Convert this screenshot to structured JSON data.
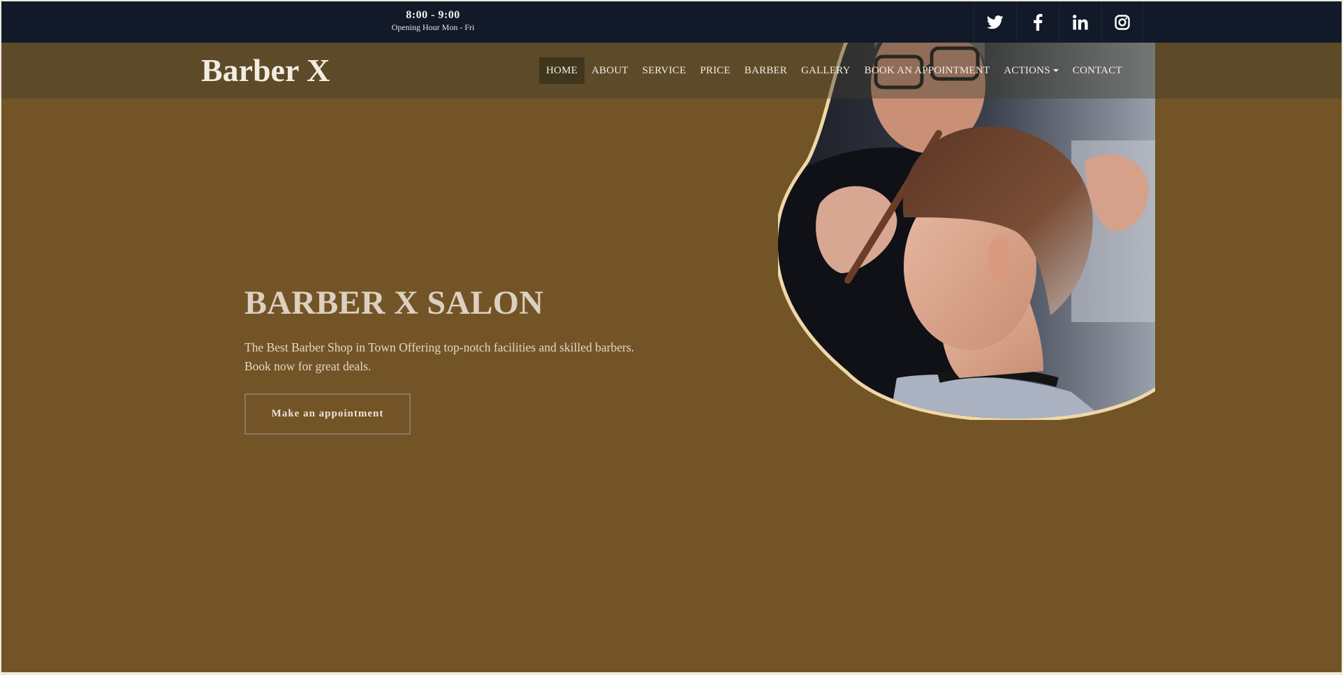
{
  "topbar": {
    "hours": "8:00 - 9:00",
    "hours_label": "Opening Hour Mon - Fri",
    "social": [
      {
        "icon": "twitter-icon"
      },
      {
        "icon": "facebook-icon"
      },
      {
        "icon": "linkedin-icon"
      },
      {
        "icon": "instagram-icon"
      }
    ]
  },
  "navbar": {
    "brand": "Barber X",
    "items": [
      {
        "label": "HOME",
        "active": true
      },
      {
        "label": "ABOUT"
      },
      {
        "label": "SERVICE"
      },
      {
        "label": "PRICE"
      },
      {
        "label": "BARBER"
      },
      {
        "label": "GALLERY"
      },
      {
        "label": "BOOK AN APPOINTMENT"
      },
      {
        "label": "ACTIONS",
        "dropdown": true
      },
      {
        "label": "CONTACT"
      }
    ]
  },
  "hero": {
    "title": "BARBER X SALON",
    "description": "The Best Barber Shop in Town Offering top-notch facilities and skilled barbers. Book now for great deals.",
    "cta_label": "Make an appointment",
    "image": "barber-cutting-hair-photo"
  },
  "colors": {
    "background": "#735427",
    "topbar": "#121a29",
    "navbar_overlay": "#413d2d",
    "title": "#dcd0c1",
    "blob_outline": "#eed8a8"
  }
}
